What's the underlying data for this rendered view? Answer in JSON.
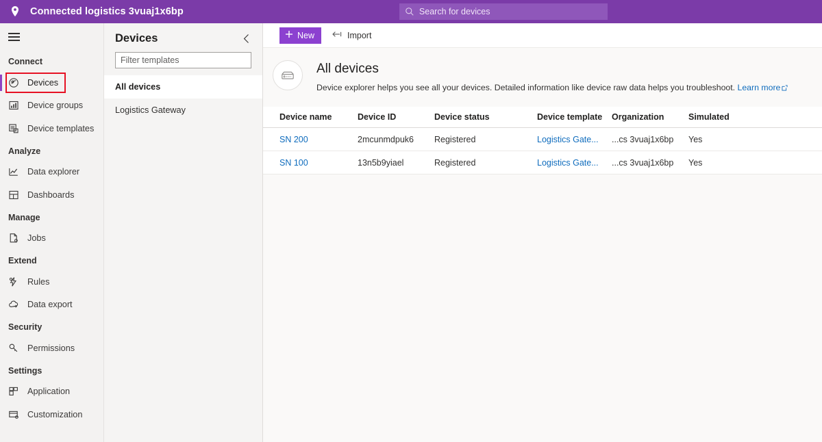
{
  "header": {
    "pin_icon": "location-pin-icon",
    "app_title": "Connected logistics 3vuaj1x6bp",
    "search": {
      "icon": "search-icon",
      "placeholder": "Search for devices",
      "value": ""
    },
    "brand_color": "#7b3ba8",
    "search_bg": "#8f57ba"
  },
  "leftnav": {
    "menu_icon": "hamburger-menu-icon",
    "highlight_color": "#e61123",
    "accent_color": "#8e44c4",
    "sections": [
      {
        "label": "Connect",
        "items": [
          {
            "label": "Devices",
            "icon": "devices-icon",
            "selected": true
          },
          {
            "label": "Device groups",
            "icon": "device-groups-icon",
            "selected": false
          },
          {
            "label": "Device templates",
            "icon": "device-templates-icon",
            "selected": false
          }
        ]
      },
      {
        "label": "Analyze",
        "items": [
          {
            "label": "Data explorer",
            "icon": "data-explorer-icon",
            "selected": false
          },
          {
            "label": "Dashboards",
            "icon": "dashboards-icon",
            "selected": false
          }
        ]
      },
      {
        "label": "Manage",
        "items": [
          {
            "label": "Jobs",
            "icon": "jobs-icon",
            "selected": false
          }
        ]
      },
      {
        "label": "Extend",
        "items": [
          {
            "label": "Rules",
            "icon": "rules-icon",
            "selected": false
          },
          {
            "label": "Data export",
            "icon": "data-export-icon",
            "selected": false
          }
        ]
      },
      {
        "label": "Security",
        "items": [
          {
            "label": "Permissions",
            "icon": "permissions-key-icon",
            "selected": false
          }
        ]
      },
      {
        "label": "Settings",
        "items": [
          {
            "label": "Application",
            "icon": "application-icon",
            "selected": false
          },
          {
            "label": "Customization",
            "icon": "customization-icon",
            "selected": false
          }
        ]
      }
    ]
  },
  "devices_panel": {
    "title": "Devices",
    "collapse_icon": "chevron-left-icon",
    "filter": {
      "placeholder": "Filter templates",
      "value": ""
    },
    "templates": [
      {
        "label": "All devices",
        "selected": true
      },
      {
        "label": "Logistics Gateway",
        "selected": false
      }
    ]
  },
  "main": {
    "commandbar": {
      "new_label": "New",
      "new_icon": "plus-icon",
      "new_color": "#8c41d0",
      "import_label": "Import",
      "import_icon": "import-arrow-icon"
    },
    "page": {
      "icon": "device-box-icon",
      "title": "All devices",
      "description": "Device explorer helps you see all your devices. Detailed information like device raw data helps you troubleshoot.",
      "learn_more_label": "Learn more",
      "learn_more_icon": "external-link-icon",
      "link_color": "#0f6cbd"
    },
    "table": {
      "columns": [
        "Device name",
        "Device ID",
        "Device status",
        "Device template",
        "Organization",
        "Simulated"
      ],
      "rows": [
        {
          "device_name": "SN 200",
          "device_id": "2mcunmdpuk6",
          "device_status": "Registered",
          "device_template": "Logistics Gate...",
          "organization": "...cs 3vuaj1x6bp",
          "simulated": "Yes"
        },
        {
          "device_name": "SN 100",
          "device_id": "13n5b9yiael",
          "device_status": "Registered",
          "device_template": "Logistics Gate...",
          "organization": "...cs 3vuaj1x6bp",
          "simulated": "Yes"
        }
      ]
    }
  }
}
